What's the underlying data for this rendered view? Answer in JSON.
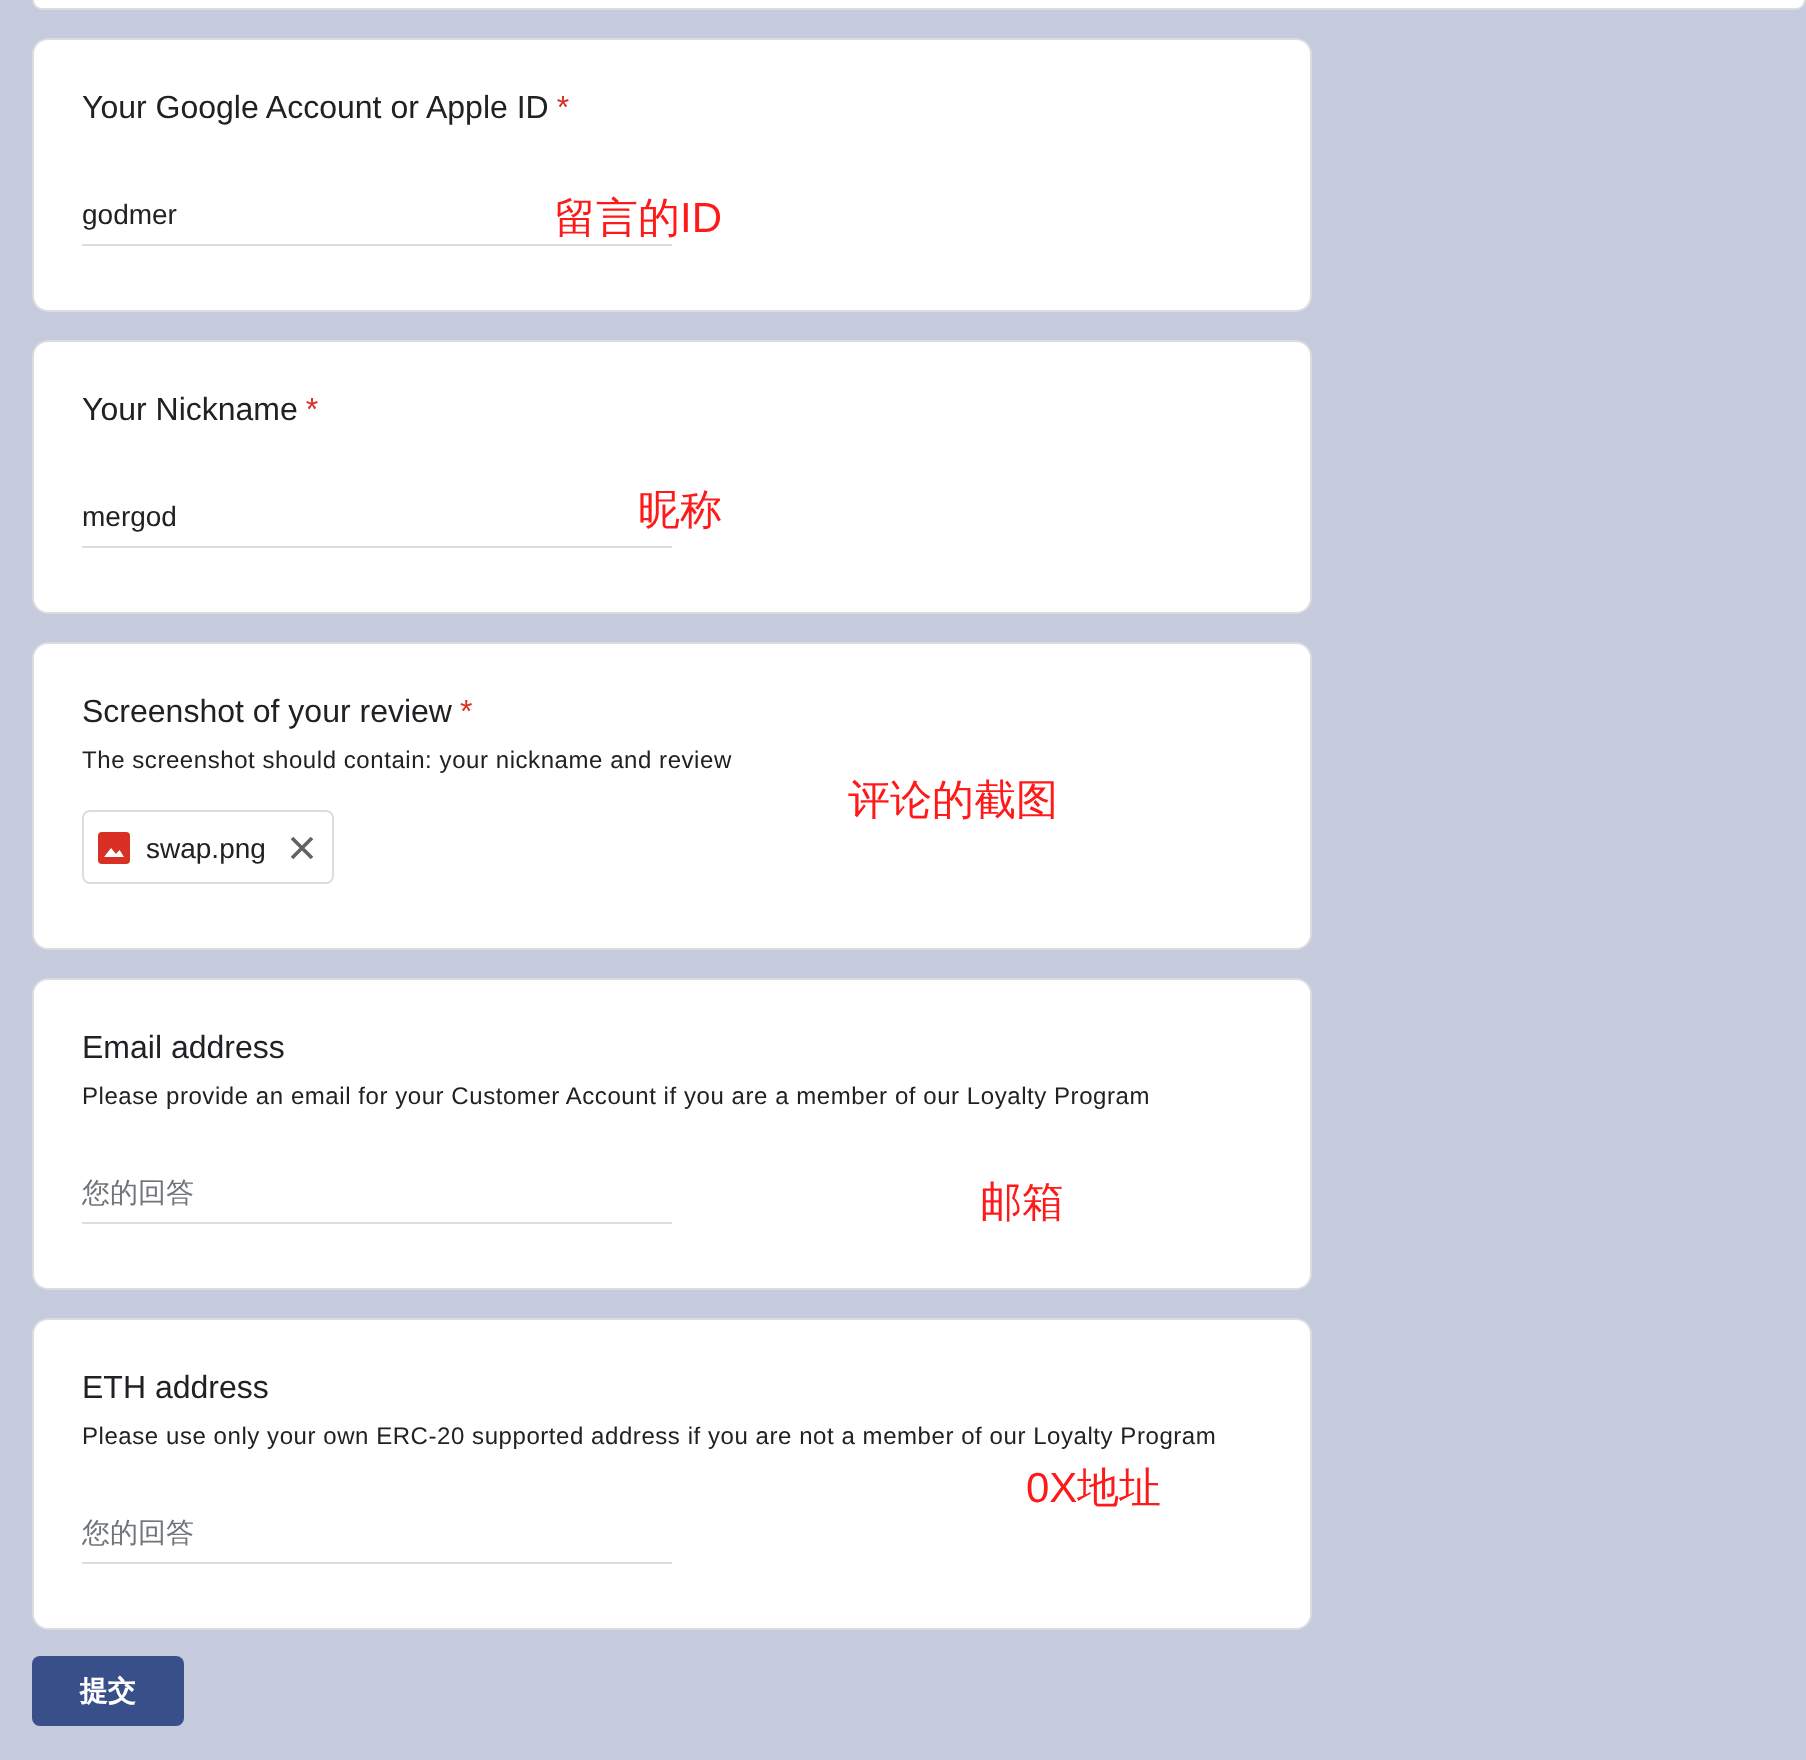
{
  "questions": [
    {
      "kind": "text",
      "title": "Your Google Account or Apple ID",
      "required_mark": "*",
      "value": "godmer",
      "annotation": "留言的ID"
    },
    {
      "kind": "text",
      "title": "Your Nickname",
      "required_mark": "*",
      "value": "mergod",
      "annotation": "昵称"
    },
    {
      "kind": "file",
      "title": "Screenshot of your review",
      "required_mark": "*",
      "description": "The screenshot should contain: your nickname and review",
      "files": [
        {
          "name": "swap.png"
        }
      ],
      "annotation": "评论的截图"
    },
    {
      "kind": "text",
      "title": "Email address",
      "description": "Please provide an email for your Customer Account if you are a member of our Loyalty Program",
      "placeholder": "您的回答",
      "annotation": "邮箱"
    },
    {
      "kind": "text",
      "title": "ETH address",
      "description": "Please use only your own ERC-20 supported address if you are not a member of our Loyalty Program",
      "placeholder": "您的回答",
      "annotation": "0X地址"
    }
  ],
  "submit_button": {
    "label": "提交"
  }
}
